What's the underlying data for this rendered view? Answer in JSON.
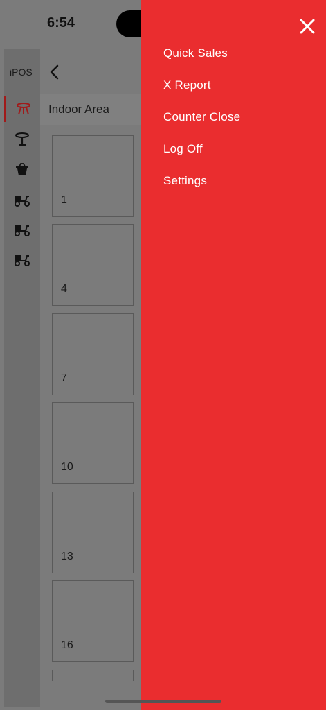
{
  "status_bar": {
    "time": "6:54"
  },
  "app": {
    "brand": "iPOS",
    "area_title": "Indoor Area",
    "rail_icons": [
      "round-table-icon",
      "bar-table-icon",
      "takeaway-bag-icon",
      "scooter-icon",
      "scooter-icon",
      "scooter-icon"
    ],
    "tables": [
      "1",
      "4",
      "7",
      "10",
      "13",
      "16"
    ]
  },
  "drawer": {
    "items": [
      "Quick Sales",
      "X Report",
      "Counter Close",
      "Log Off",
      "Settings"
    ]
  },
  "colors": {
    "drawer_bg": "#ea2d2f",
    "overlay_bg": "#7b7b7b",
    "accent": "#a11a1a"
  }
}
